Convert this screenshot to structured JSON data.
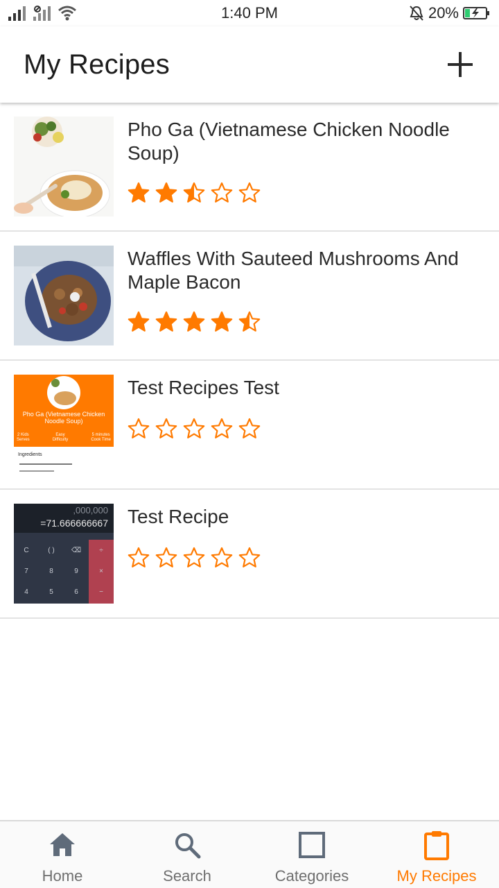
{
  "status_bar": {
    "time": "1:40 PM",
    "battery": "20%",
    "icons": [
      "signal-icon",
      "signal-off-icon",
      "wifi-icon",
      "notifications-muted-icon",
      "battery-charging-icon"
    ]
  },
  "app_bar": {
    "title": "My Recipes",
    "add_icon": "plus-icon"
  },
  "recipes": [
    {
      "title": "Pho Ga (Vietnamese Chicken Noodle Soup)",
      "rating": 2.5,
      "thumbnail": "pho-photo"
    },
    {
      "title": "Waffles With Sauteed Mushrooms And Maple Bacon",
      "rating": 4.5,
      "thumbnail": "waffles-photo"
    },
    {
      "title": "Test Recipes Test",
      "rating": 0,
      "thumbnail": "screenshot-thumbnail",
      "thumb_text": {
        "title": "Pho Ga (Vietnamese Chicken Noodle Soup)",
        "meta1_value": "2 Kids",
        "meta1_label": "Serves",
        "meta2_value": "Easy",
        "meta2_label": "Difficulty",
        "meta3_value": "5 minutes",
        "meta3_label": "Cook Time",
        "ingredients_label": "Ingredients"
      }
    },
    {
      "title": "Test Recipe",
      "rating": 0,
      "thumbnail": "calculator-screenshot",
      "thumb_text": {
        "line1": ",000,000",
        "line2": "=71.666666667",
        "keys": [
          [
            "C",
            "( )",
            "⌫",
            "÷"
          ],
          [
            "7",
            "8",
            "9",
            "×"
          ],
          [
            "4",
            "5",
            "6",
            "−"
          ]
        ]
      }
    }
  ],
  "bottom_nav": [
    {
      "label": "Home",
      "icon": "home-icon",
      "active": false
    },
    {
      "label": "Search",
      "icon": "search-icon",
      "active": false
    },
    {
      "label": "Categories",
      "icon": "categories-icon",
      "active": false
    },
    {
      "label": "My Recipes",
      "icon": "clipboard-icon",
      "active": true
    }
  ],
  "colors": {
    "accent": "#ff7a00",
    "nav_inactive": "#6e6e6e",
    "divider": "#e3e3e3"
  }
}
